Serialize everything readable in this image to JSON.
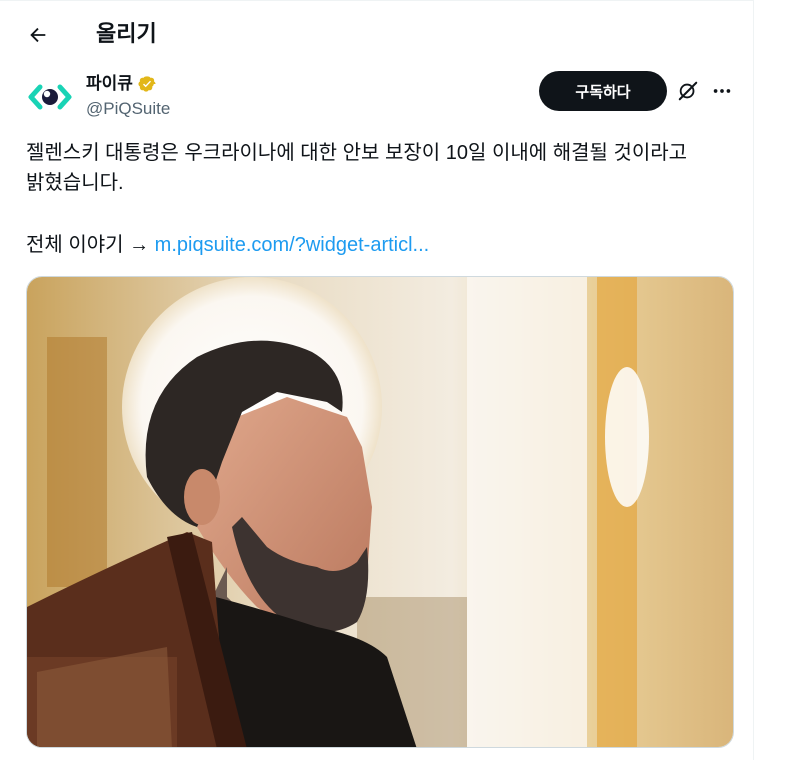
{
  "header": {
    "title": "올리기"
  },
  "author": {
    "display_name": "파이큐",
    "handle": "@PiQSuite",
    "verified": true
  },
  "actions": {
    "subscribe_label": "구독하다"
  },
  "tweet": {
    "text": "젤렌스키 대통령은 우크라이나에 대한 안보 보장이 10일 이내에 해결될 것이라고\n밝혔습니다.",
    "link_prefix": "전체 이야기 → ",
    "link_text": "m.piqsuite.com/?widget-articl..."
  },
  "colors": {
    "accent": "#1d9bf0",
    "subscribe_bg": "#0f1419",
    "verified_gold": "#e2b719",
    "logo_teal": "#19d3b5",
    "logo_dark": "#1b1b3a"
  },
  "icons": {
    "back": "arrow-left-icon",
    "verified": "verified-badge-icon",
    "grok": "grok-icon",
    "more": "more-horizontal-icon"
  }
}
